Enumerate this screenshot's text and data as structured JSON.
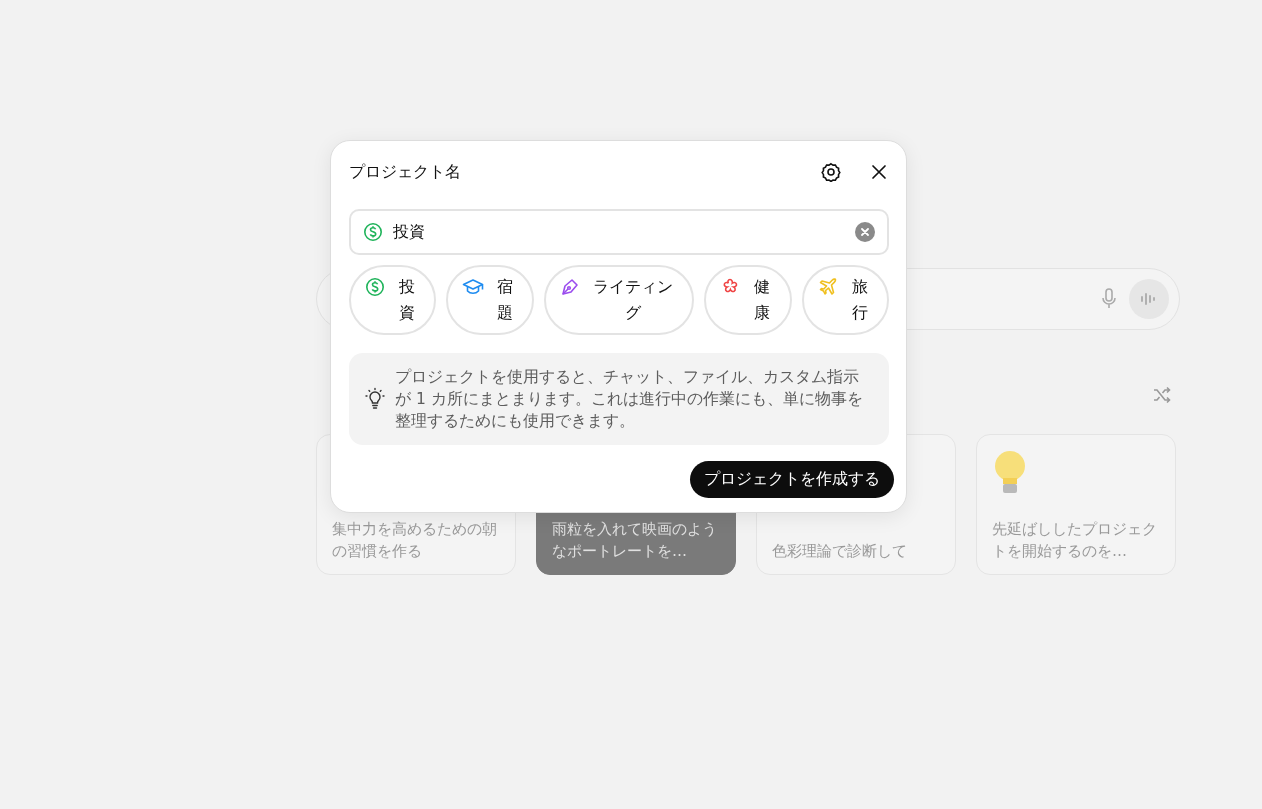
{
  "background": {
    "cards": [
      {
        "kind": "plain",
        "text": "集中力を高めるための朝の習慣を作る"
      },
      {
        "kind": "photo",
        "text": "雨粒を入れて映画のようなポートレートを…"
      },
      {
        "kind": "plain",
        "text": "色彩理論で診断して"
      },
      {
        "kind": "bulb",
        "text": "先延ばししたプロジェクトを開始するのを…"
      }
    ]
  },
  "dialog": {
    "title": "プロジェクト名",
    "name_field": {
      "value": "投資"
    },
    "chips": [
      {
        "label": "投資",
        "color": "#1fb35a"
      },
      {
        "label": "宿題",
        "color": "#1f8cf0"
      },
      {
        "label": "ライティング",
        "color": "#9b4dee"
      },
      {
        "label": "健康",
        "color": "#ef4444"
      },
      {
        "label": "旅行",
        "color": "#f0c020"
      }
    ],
    "info": "プロジェクトを使用すると、チャット、ファイル、カスタム指示が 1 カ所にまとまります。これは進行中の作業にも、単に物事を整理するためにも使用できます。",
    "create_button": "プロジェクトを作成する"
  }
}
